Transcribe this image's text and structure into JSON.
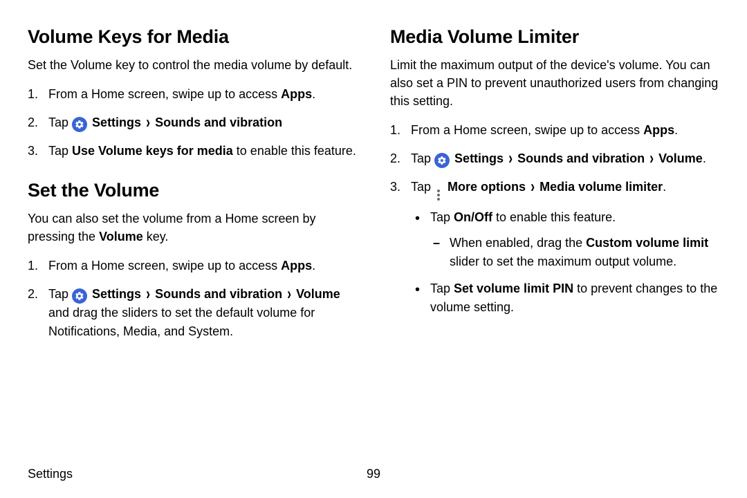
{
  "left": {
    "section1": {
      "title": "Volume Keys for Media",
      "intro": "Set the Volume key to control the media volume by default.",
      "steps": {
        "s1_pre": "From a Home screen, swipe up to access ",
        "s1_bold": "Apps",
        "s1_post": ".",
        "s2_pre": "Tap ",
        "s2_settings": "Settings",
        "s2_sounds": "Sounds and vibration",
        "s3_pre": "Tap ",
        "s3_bold": "Use Volume keys for media",
        "s3_post": " to enable this feature."
      }
    },
    "section2": {
      "title": "Set the Volume",
      "intro_pre": "You can also set the volume from a Home screen by pressing the ",
      "intro_bold": "Volume",
      "intro_post": " key.",
      "steps": {
        "s1_pre": "From a Home screen, swipe up to access ",
        "s1_bold": "Apps",
        "s1_post": ".",
        "s2_pre": "Tap ",
        "s2_settings": "Settings",
        "s2_sounds": "Sounds and vibration",
        "s2_volume": "Volume",
        "s2_post": " and drag the sliders to set the default volume for Notifications, Media, and System."
      }
    }
  },
  "right": {
    "section1": {
      "title": "Media Volume Limiter",
      "intro": "Limit the maximum output of the device's volume. You can also set a PIN to prevent unauthorized users from changing this setting.",
      "steps": {
        "s1_pre": "From a Home screen, swipe up to access ",
        "s1_bold": "Apps",
        "s1_post": ".",
        "s2_pre": "Tap ",
        "s2_settings": "Settings",
        "s2_sounds": "Sounds and vibration",
        "s2_volume": "Volume",
        "s2_post": ".",
        "s3_pre": "Tap ",
        "s3_more": "More options",
        "s3_media": "Media volume limiter",
        "s3_post": ".",
        "b1_pre": "Tap ",
        "b1_bold": "On/Off",
        "b1_post": " to enable this feature.",
        "d1_pre": "When enabled, drag the ",
        "d1_bold": "Custom volume limit",
        "d1_post": " slider to set the maximum output volume.",
        "b2_pre": "Tap ",
        "b2_bold": "Set volume limit PIN",
        "b2_post": " to prevent changes to the volume setting."
      }
    }
  },
  "footer": {
    "section": "Settings",
    "page": "99"
  },
  "glyphs": {
    "chevron": "›"
  }
}
